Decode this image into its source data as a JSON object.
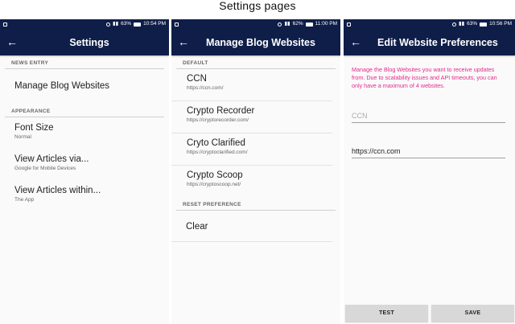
{
  "page_title": "Settings pages",
  "screens": [
    {
      "status": {
        "left": "",
        "right": "63%",
        "time": "10:54 PM"
      },
      "toolbar_title": "Settings",
      "categories": {
        "news_entry": "NEWS ENTRY",
        "appearance": "APPEARANCE"
      },
      "items": {
        "manage": {
          "title": "Manage Blog Websites"
        },
        "font_size": {
          "title": "Font Size",
          "summary": "Normal"
        },
        "view_via": {
          "title": "View Articles via...",
          "summary": "Google for Mobile Devices"
        },
        "view_within": {
          "title": "View Articles within...",
          "summary": "The App"
        }
      }
    },
    {
      "status": {
        "left": "",
        "right": "62%",
        "time": "11:00 PM"
      },
      "toolbar_title": "Manage Blog Websites",
      "categories": {
        "default": "DEFAULT",
        "reset": "RESET PREFERENCE"
      },
      "sites": [
        {
          "title": "CCN",
          "url": "https://ccn.com/"
        },
        {
          "title": "Crypto Recorder",
          "url": "https://cryptorecorder.com/"
        },
        {
          "title": "Cryto Clarified",
          "url": "https://cryptoclarified.com/"
        },
        {
          "title": "Crypto Scoop",
          "url": "https://cryptoscoop.net/"
        }
      ],
      "clear_label": "Clear"
    },
    {
      "status": {
        "left": "",
        "right": "63%",
        "time": "10:56 PM"
      },
      "toolbar_title": "Edit Website Preferences",
      "description": "Manage the Blog Websites you want to receive updates from. Due to scalability issues and API timeouts, you can only have a maximum of 4 websites.",
      "field1_placeholder": "CCN",
      "field2_value": "https://ccn.com",
      "test_label": "TEST",
      "save_label": "SAVE"
    }
  ],
  "colors": {
    "toolbar": "#0f1e48",
    "description": "#e8288c",
    "button": "#d8d8d8"
  },
  "icons": {
    "back": "back-arrow-icon",
    "battery": "battery-icon",
    "wifi": "wifi-icon",
    "signal": "signal-icon"
  }
}
